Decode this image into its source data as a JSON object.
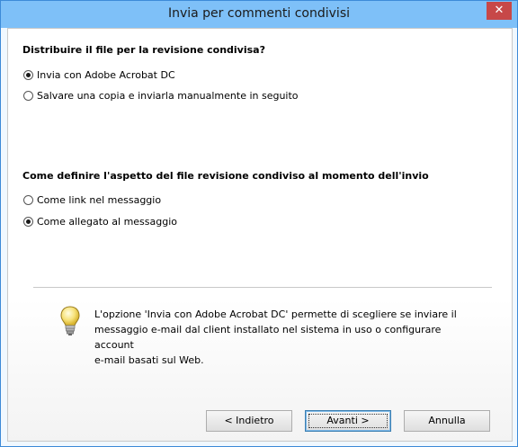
{
  "window": {
    "title": "Invia per commenti condivisi",
    "close_label": "✕"
  },
  "section1": {
    "heading": "Distribuire il file per la revisione condivisa?",
    "options": [
      {
        "label": "Invia con Adobe Acrobat DC",
        "selected": true
      },
      {
        "label": "Salvare una copia e inviarla manualmente in seguito",
        "selected": false
      }
    ]
  },
  "section2": {
    "heading": "Come definire l'aspetto del file revisione condiviso al momento dell'invio",
    "options": [
      {
        "label": "Come link nel messaggio",
        "selected": false
      },
      {
        "label": "Come allegato al messaggio",
        "selected": true
      }
    ]
  },
  "info": {
    "icon": "lightbulb-icon",
    "lines": [
      "L'opzione 'Invia con Adobe Acrobat DC' permette di scegliere se inviare il",
      "messaggio e-mail dal client installato nel sistema in uso o configurare account",
      "e-mail basati sul Web."
    ]
  },
  "buttons": {
    "back": "< Indietro",
    "next": "Avanti >",
    "cancel": "Annulla"
  }
}
